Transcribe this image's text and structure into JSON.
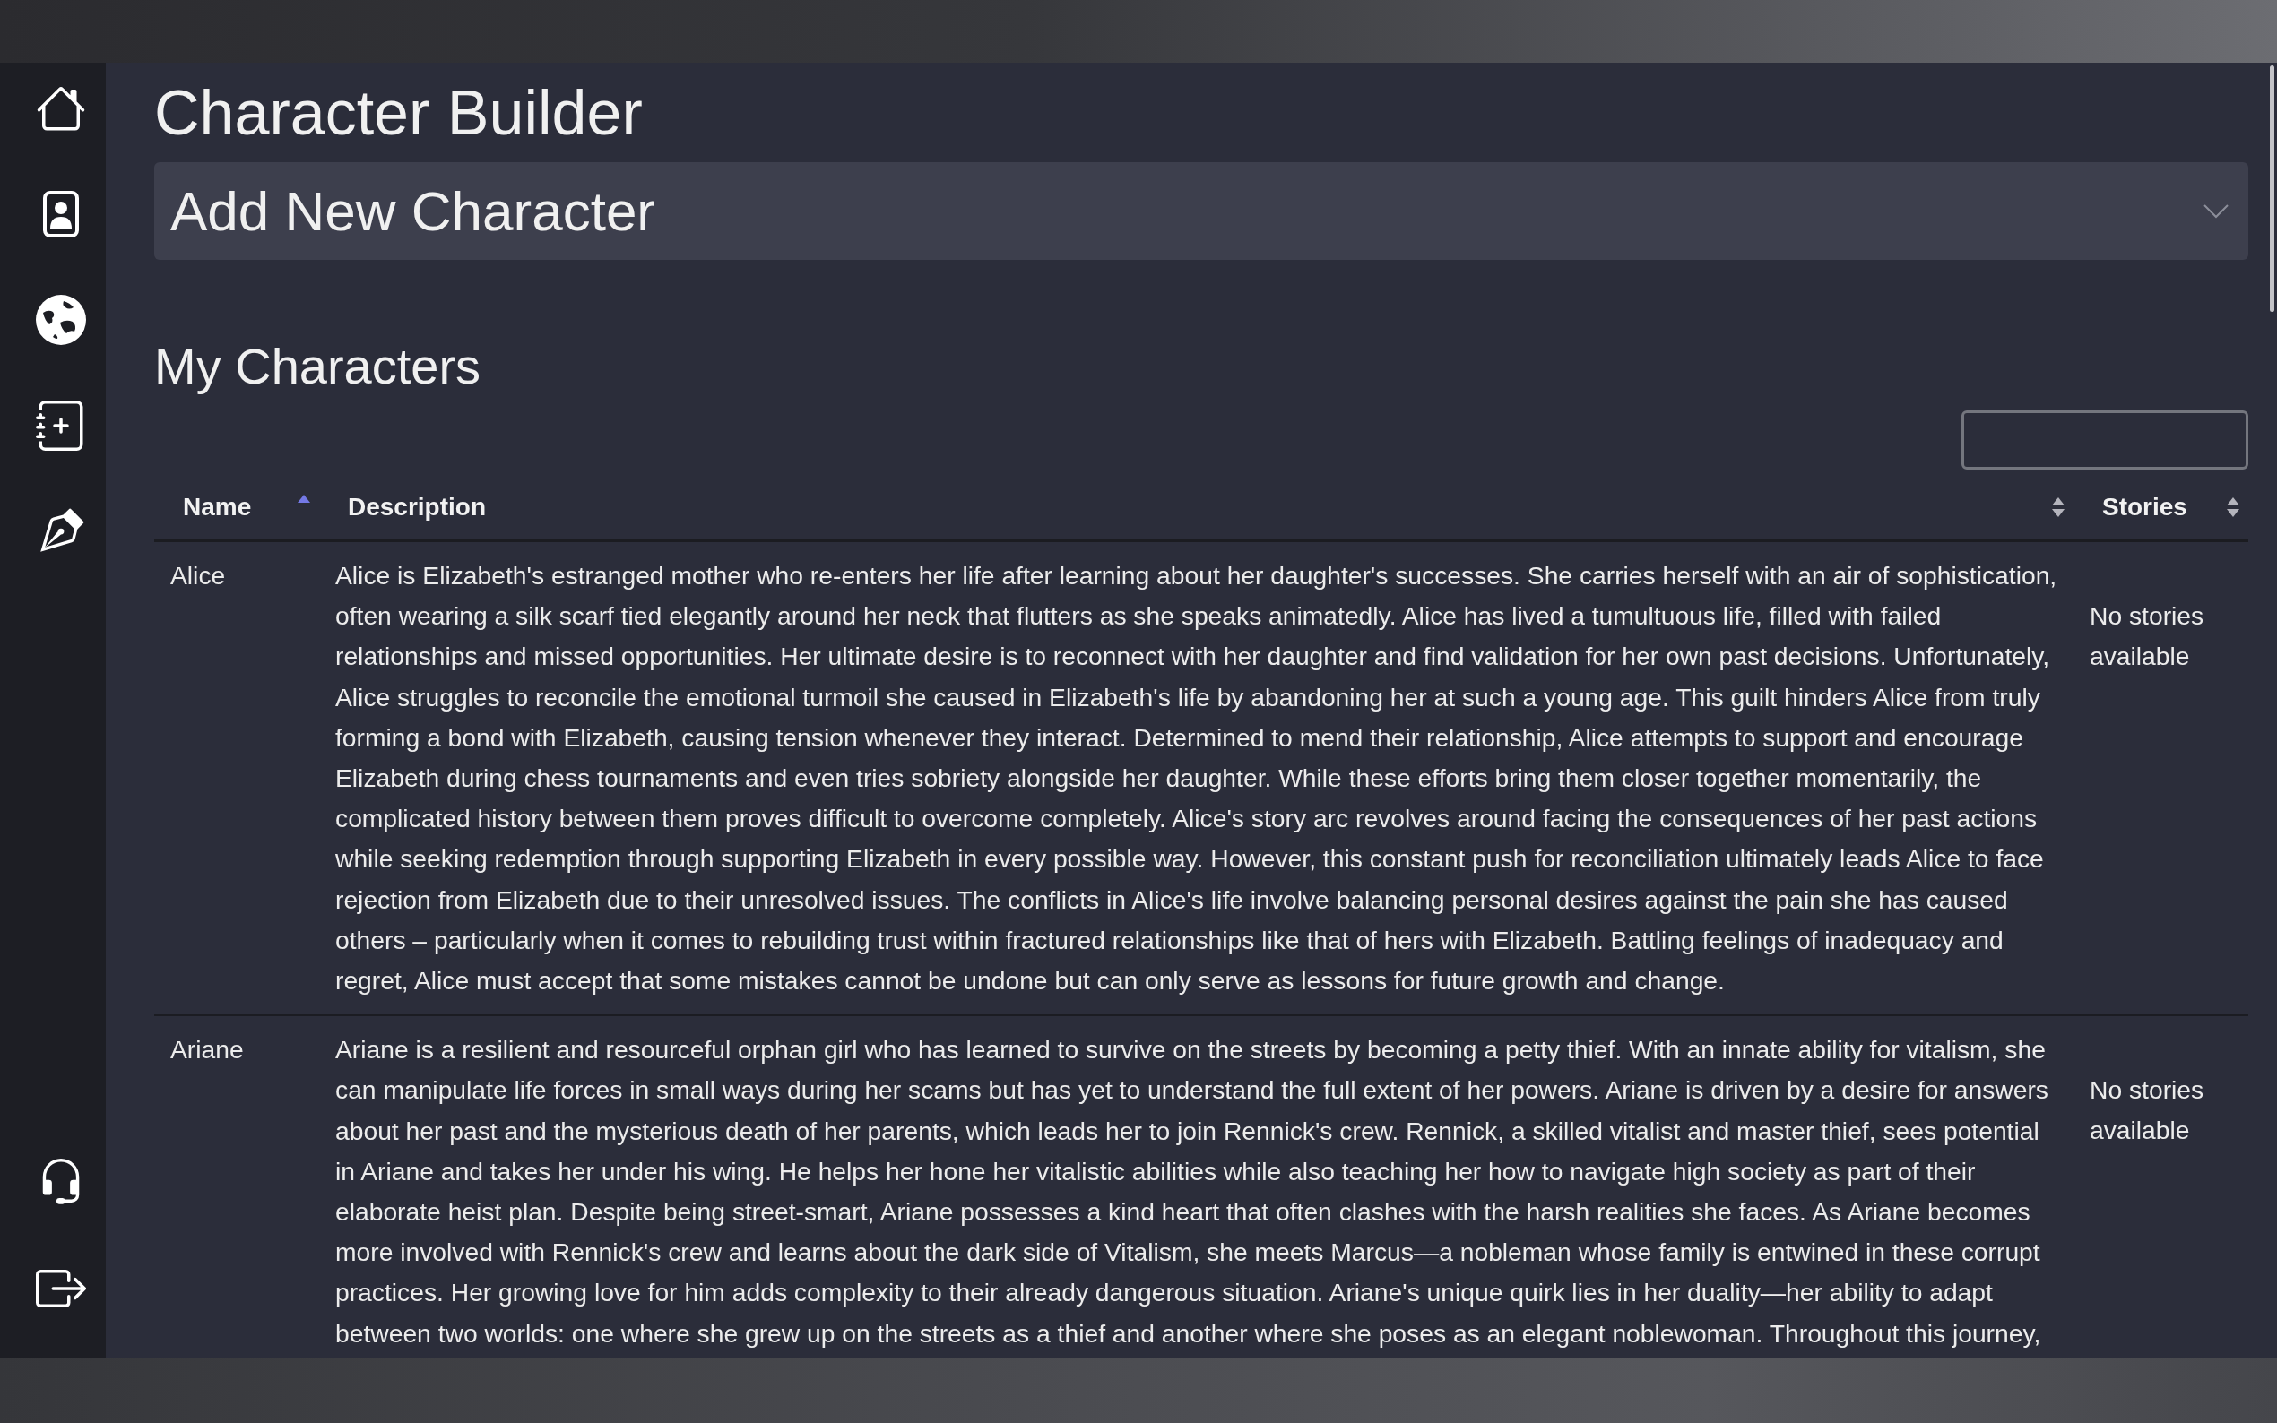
{
  "page": {
    "title": "Character Builder"
  },
  "add_panel": {
    "label": "Add New Character",
    "expanded": false
  },
  "characters": {
    "heading": "My Characters",
    "table": {
      "columns": [
        {
          "label": "Name",
          "sorted": true
        },
        {
          "label": "Description",
          "sorted": false
        },
        {
          "label": "Stories",
          "sorted": false
        }
      ],
      "rows": [
        {
          "name": "Alice",
          "description": "Alice is Elizabeth's estranged mother who re-enters her life after learning about her daughter's successes. She carries herself with an air of sophistication, often wearing a silk scarf tied elegantly around her neck that flutters as she speaks animatedly. Alice has lived a tumultuous life, filled with failed relationships and missed opportunities. Her ultimate desire is to reconnect with her daughter and find validation for her own past decisions. Unfortunately, Alice struggles to reconcile the emotional turmoil she caused in Elizabeth's life by abandoning her at such a young age. This guilt hinders Alice from truly forming a bond with Elizabeth, causing tension whenever they interact. Determined to mend their relationship, Alice attempts to support and encourage Elizabeth during chess tournaments and even tries sobriety alongside her daughter. While these efforts bring them closer together momentarily, the complicated history between them proves difficult to overcome completely. Alice's story arc revolves around facing the consequences of her past actions while seeking redemption through supporting Elizabeth in every possible way. However, this constant push for reconciliation ultimately leads Alice to face rejection from Elizabeth due to their unresolved issues. The conflicts in Alice's life involve balancing personal desires against the pain she has caused others – particularly when it comes to rebuilding trust within fractured relationships like that of hers with Elizabeth. Battling feelings of inadequacy and regret, Alice must accept that some mistakes cannot be undone but can only serve as lessons for future growth and change.",
          "stories": "No stories available"
        },
        {
          "name": "Ariane",
          "description": "Ariane is a resilient and resourceful orphan girl who has learned to survive on the streets by becoming a petty thief. With an innate ability for vitalism, she can manipulate life forces in small ways during her scams but has yet to understand the full extent of her powers. Ariane is driven by a desire for answers about her past and the mysterious death of her parents, which leads her to join Rennick's crew. Rennick, a skilled vitalist and master thief, sees potential in Ariane and takes her under his wing. He helps her hone her vitalistic abilities while also teaching her how to navigate high society as part of their elaborate heist plan. Despite being street-smart, Ariane possesses a kind heart that often clashes with the harsh realities she faces. As Ariane becomes more involved with Rennick's crew and learns about the dark side of Vitalism, she meets Marcus—a nobleman whose family is entwined in these corrupt practices. Her growing love for him adds complexity to their already dangerous situation. Ariane's unique quirk lies in her duality—her ability to adapt between two worlds: one where she grew up on the streets as a thief and another where she poses as an elegant noblewoman. Throughout this journey,",
          "stories": "No stories available"
        }
      ]
    }
  }
}
